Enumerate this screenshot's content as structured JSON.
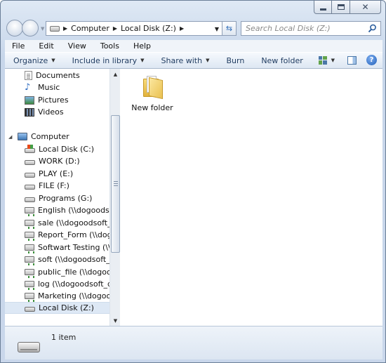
{
  "window": {
    "close_glyph": "✕"
  },
  "address_bar": {
    "segments": [
      "Computer",
      "Local Disk (Z:)"
    ]
  },
  "search": {
    "placeholder": "Search Local Disk (Z:)"
  },
  "menu": [
    "File",
    "Edit",
    "View",
    "Tools",
    "Help"
  ],
  "toolbar": {
    "organize": "Organize",
    "include_in_library": "Include in library",
    "share_with": "Share with",
    "burn": "Burn",
    "new_folder": "New folder",
    "help_glyph": "?"
  },
  "nav_tree": {
    "libraries": [
      {
        "label": "Documents",
        "icon": "documents-icon"
      },
      {
        "label": "Music",
        "icon": "music-icon"
      },
      {
        "label": "Pictures",
        "icon": "pictures-icon"
      },
      {
        "label": "Videos",
        "icon": "videos-icon"
      }
    ],
    "computer_label": "Computer",
    "drives": [
      {
        "label": "Local Disk (C:)",
        "type": "system"
      },
      {
        "label": "WORK (D:)",
        "type": "local"
      },
      {
        "label": "PLAY (E:)",
        "type": "local"
      },
      {
        "label": "FILE (F:)",
        "type": "local"
      },
      {
        "label": "Programs (G:)",
        "type": "local"
      },
      {
        "label": "English (\\\\dogoodsoft_d",
        "type": "network"
      },
      {
        "label": "sale (\\\\dogoodsoft_disk)",
        "type": "network"
      },
      {
        "label": "Report_Form (\\\\dogood",
        "type": "network"
      },
      {
        "label": "Softwart Testing (\\\\dogo",
        "type": "network"
      },
      {
        "label": "soft (\\\\dogoodsoft_disk)",
        "type": "network"
      },
      {
        "label": "public_file (\\\\dogoodsof",
        "type": "network"
      },
      {
        "label": "log (\\\\dogoodsoft_disk)",
        "type": "network"
      },
      {
        "label": "Marketing (\\\\dogoodsof",
        "type": "network"
      },
      {
        "label": "Local Disk (Z:)",
        "type": "local",
        "selected": true
      }
    ]
  },
  "files": [
    {
      "name": "New folder",
      "type": "folder"
    }
  ],
  "details": {
    "item_count": "1 item"
  }
}
